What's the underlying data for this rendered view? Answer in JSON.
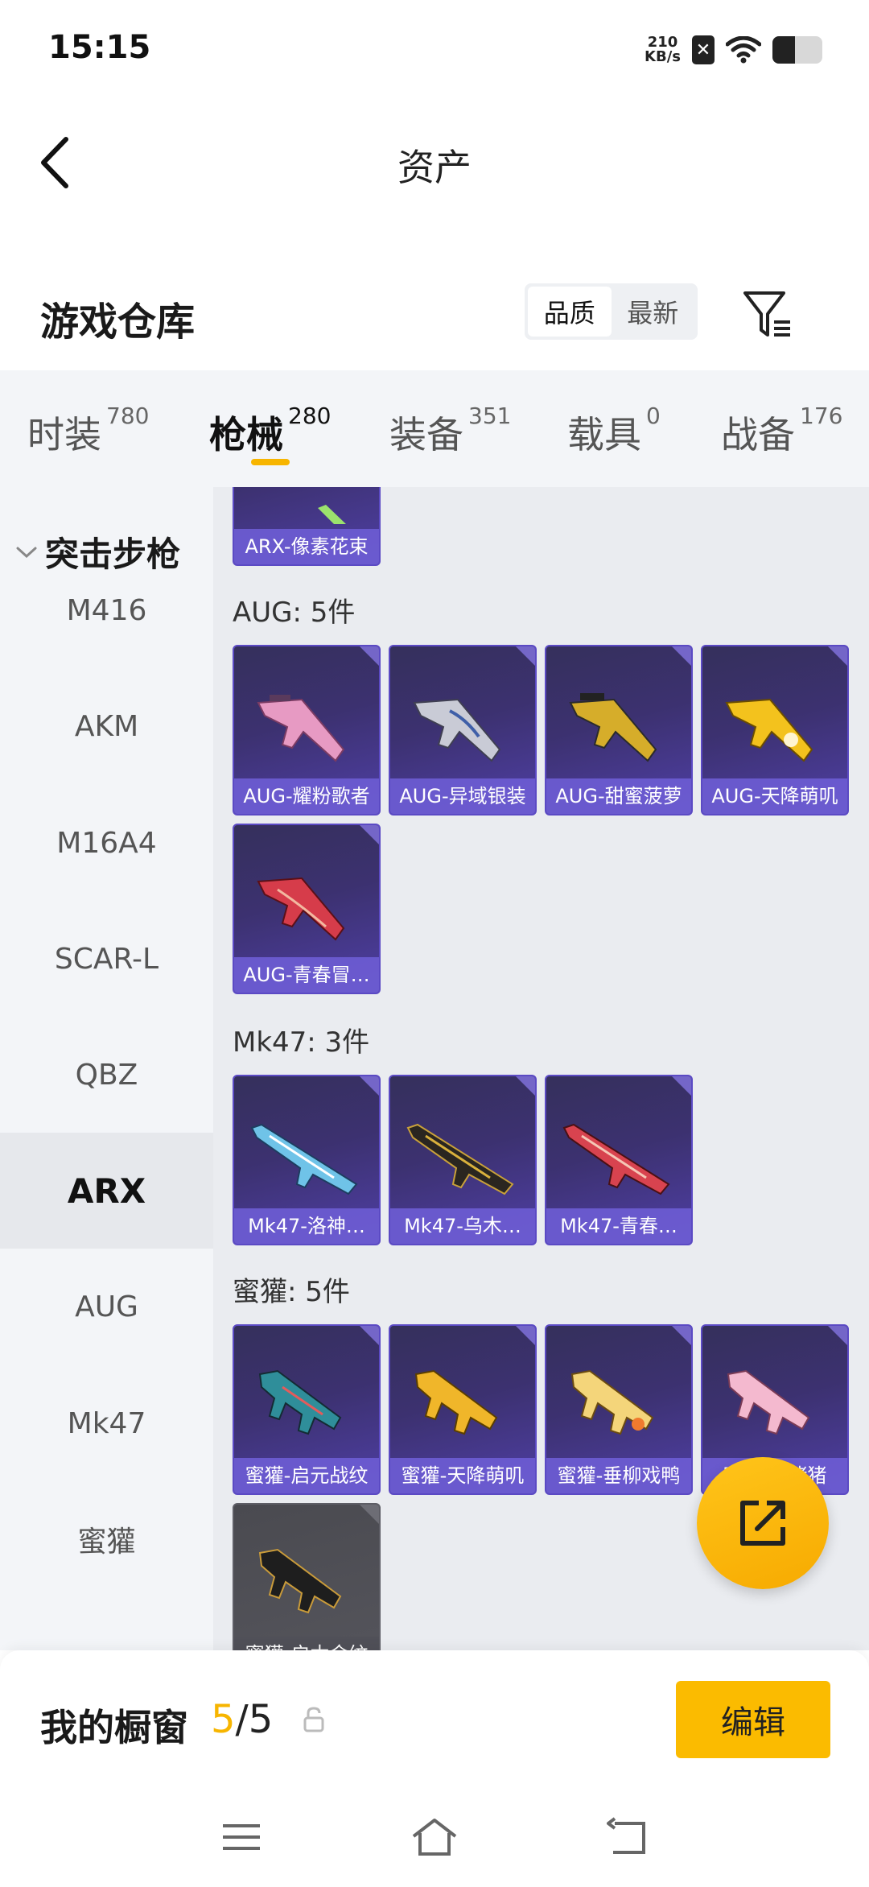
{
  "status_bar": {
    "time": "15:15",
    "net_speed_value": "210",
    "net_speed_unit": "KB/s",
    "battery_level": 0.45
  },
  "header": {
    "title": "资产"
  },
  "warehouse": {
    "title": "游戏仓库",
    "sort_options": [
      "品质",
      "最新"
    ],
    "active_sort": "品质"
  },
  "tabs": [
    {
      "label": "时装",
      "count": "780"
    },
    {
      "label": "枪械",
      "count": "280"
    },
    {
      "label": "装备",
      "count": "351"
    },
    {
      "label": "载具",
      "count": "0"
    },
    {
      "label": "战备",
      "count": "176"
    }
  ],
  "active_tab": "枪械",
  "sidebar": {
    "group": "突击步枪",
    "items": [
      "M416",
      "AKM",
      "M16A4",
      "SCAR-L",
      "QBZ",
      "ARX",
      "AUG",
      "Mk47",
      "蜜獾"
    ],
    "active": "ARX"
  },
  "content": {
    "arx_tail_item": "ARX-像素花束",
    "groups": [
      {
        "label": "AUG: 5件",
        "items": [
          "AUG-耀粉歌者",
          "AUG-异域银装",
          "AUG-甜蜜菠萝",
          "AUG-天降萌叽",
          "AUG-青春冒…"
        ]
      },
      {
        "label": "Mk47: 3件",
        "items": [
          "Mk47-洛神…",
          "Mk47-乌木…",
          "Mk47-青春…"
        ]
      },
      {
        "label": "蜜獾: 5件",
        "items": [
          "蜜獾-启元战纹",
          "蜜獾-天降萌叽",
          "蜜獾-垂柳戏鸭",
          "蜜獾-…猪猪",
          "蜜獾-启木金纹"
        ]
      }
    ]
  },
  "showcase": {
    "label": "我的橱窗",
    "current": "5",
    "separator": "/",
    "total": "5",
    "edit_label": "编辑"
  },
  "colors": {
    "accent": "#f7b500",
    "card_purple": "#3c3170",
    "card_label": "#6c5cd2"
  }
}
